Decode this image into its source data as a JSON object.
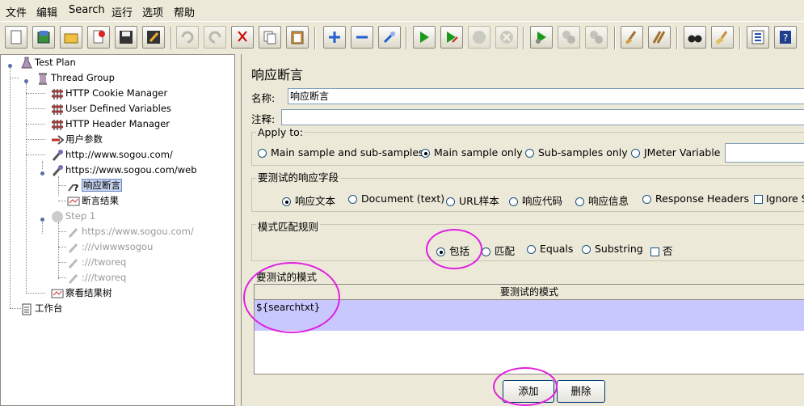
{
  "menu": [
    "文件",
    "编辑",
    "Search",
    "运行",
    "选项",
    "帮助"
  ],
  "toolbar_icons": [
    "new-icon",
    "templates-icon",
    "open-icon",
    "close-icon",
    "save-icon",
    "save-as-icon",
    "undo-icon",
    "redo-icon",
    "cut-icon",
    "copy-icon",
    "paste-icon",
    "expand-icon",
    "collapse-icon",
    "toggle-icon",
    "start-icon",
    "start-no-pause-icon",
    "stop-icon",
    "shutdown-icon",
    "remote-start-icon",
    "remote-stop-icon",
    "remote-shutdown-icon",
    "clear-icon",
    "clear-all-icon",
    "search-icon",
    "reset-search-icon",
    "function-helper-icon",
    "help-icon"
  ],
  "tree": {
    "test_plan": "Test Plan",
    "thread_group": "Thread Group",
    "cookie_manager": "HTTP Cookie Manager",
    "user_defined_variables": "User Defined Variables",
    "header_manager": "HTTP Header Manager",
    "user_params": "用户参数",
    "sampler1": "http://www.sogou.com/",
    "sampler2": "https://www.sogou.com/web",
    "response_assertion": "响应断言",
    "assertion_results": "断言结果",
    "step1": "Step 1",
    "step1_children": [
      "https://www.sogou.com/",
      ":///viwwwsogou",
      ":///tworeq",
      ":///tworeq"
    ],
    "view_results_tree": "察看结果树",
    "workbench": "工作台"
  },
  "panel": {
    "title": "响应断言",
    "name_label": "名称:",
    "name_value": "响应断言",
    "comment_label": "注释:",
    "comment_value": "",
    "apply_to": {
      "title": "Apply to:",
      "options": [
        "Main sample and sub-samples",
        "Main sample only",
        "Sub-samples only",
        "JMeter Variable"
      ],
      "selected": "Main sample only",
      "variable_value": ""
    },
    "response_field": {
      "title": "要测试的响应字段",
      "options": [
        "响应文本",
        "Document (text)",
        "URL样本",
        "响应代码",
        "响应信息",
        "Response Headers"
      ],
      "selected": "响应文本",
      "ignore_status": "Ignore S"
    },
    "pattern_rules": {
      "title": "模式匹配规则",
      "options": [
        "包括",
        "匹配",
        "Equals",
        "Substring"
      ],
      "selected": "包括",
      "not_label": "否"
    },
    "patterns": {
      "title": "要测试的模式",
      "column_header": "要测试的模式",
      "rows": [
        "${searchtxt}"
      ]
    },
    "add_button": "添加",
    "delete_button": "删除"
  },
  "colors": {
    "highlight_circle": "#e020e0",
    "selected_row": "#c8c8ff"
  }
}
